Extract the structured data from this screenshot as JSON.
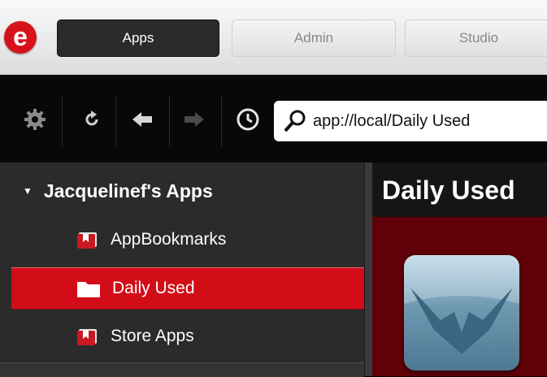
{
  "app": {
    "logo_letter": "e"
  },
  "top_tabs": [
    {
      "label": "Apps",
      "active": true
    },
    {
      "label": "Admin",
      "active": false
    },
    {
      "label": "Studio",
      "active": false
    }
  ],
  "toolbar": {
    "buttons": [
      "settings-icon",
      "refresh-icon",
      "back-arrow-icon",
      "forward-arrow-icon",
      "history-clock-icon"
    ],
    "address": {
      "icon": "search-icon",
      "value": "app://local/Daily Used"
    }
  },
  "sidebar": {
    "group": {
      "label": "Jacquelinef's Apps",
      "expanded": true
    },
    "items": [
      {
        "label": "AppBookmarks",
        "icon": "bookmark-folder-icon",
        "selected": false
      },
      {
        "label": "Daily Used",
        "icon": "folder-icon",
        "selected": true
      },
      {
        "label": "Store Apps",
        "icon": "bookmark-folder-icon",
        "selected": false
      }
    ]
  },
  "main": {
    "title": "Daily Used",
    "tile_icon": "app-bird-icon"
  },
  "colors": {
    "accent": "#d20d18",
    "main_bg": "#600008",
    "sidebar_bg": "#2b2b2b"
  }
}
